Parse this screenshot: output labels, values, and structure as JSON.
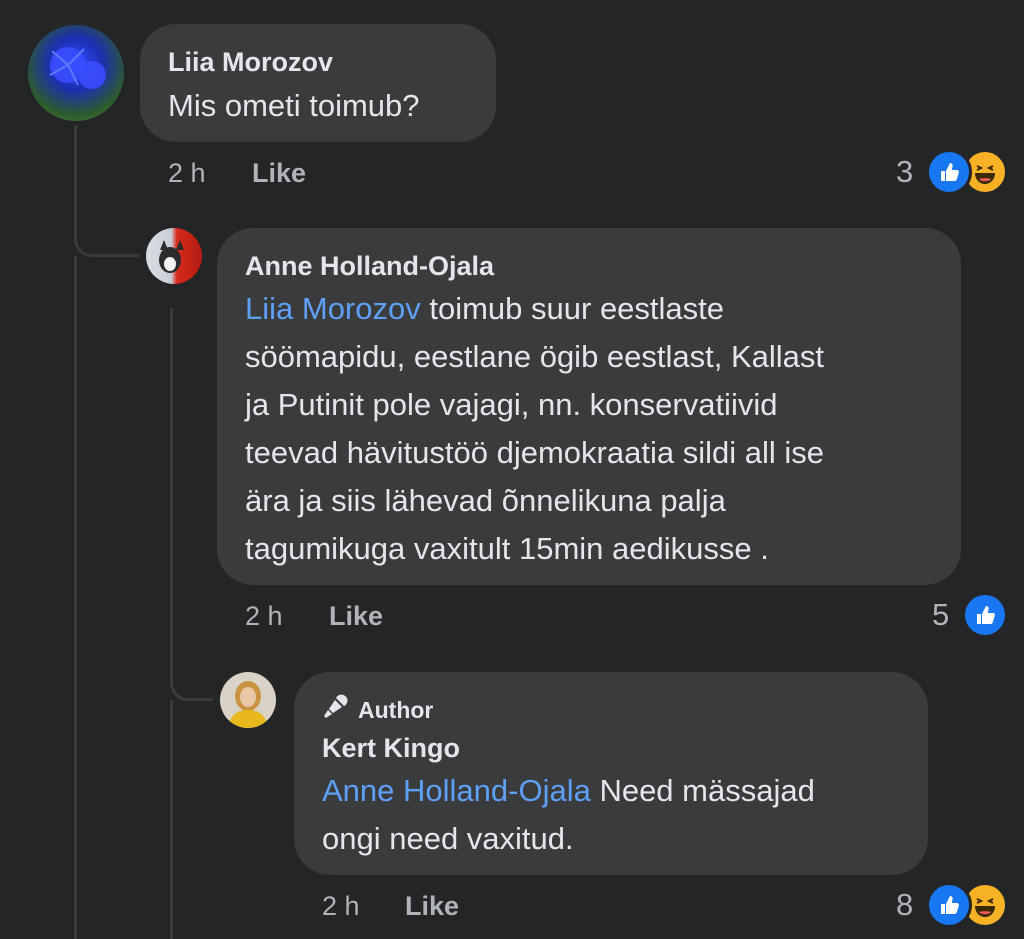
{
  "comments": [
    {
      "author": "Liia Morozov",
      "text": "Mis ometi toimub?",
      "time": "2 h",
      "like_label": "Like",
      "reaction_count": "3",
      "reactions": [
        "like-icon",
        "haha-icon"
      ]
    },
    {
      "author": "Anne Holland-Ojala",
      "mention": "Liia Morozov",
      "text_lines": [
        " toimub suur eestlaste",
        "söömapidu, eestlane ögib eestlast, Kallast",
        "ja Putinit pole vajagi, nn. konservatiivid",
        "teevad hävitustöö djemokraatia sildi all ise",
        "ära ja siis lähevad õnnelikuna palja",
        "tagumikuga vaxitult 15min aedikusse ."
      ],
      "time": "2 h",
      "like_label": "Like",
      "reaction_count": "5",
      "reactions": [
        "like-icon"
      ]
    },
    {
      "badge": "Author",
      "author": "Kert Kingo",
      "mention": "Anne Holland-Ojala",
      "text_lines": [
        " Need mässajad",
        "ongi need vaxitud."
      ],
      "time": "2 h",
      "like_label": "Like",
      "reaction_count": "8",
      "reactions": [
        "like-icon",
        "haha-icon"
      ]
    }
  ],
  "colors": {
    "background": "#242526",
    "bubble": "#3a3b3c",
    "mention": "#5ea0f6",
    "like_blue": "#1877f2",
    "haha_yellow": "#f7b125"
  }
}
